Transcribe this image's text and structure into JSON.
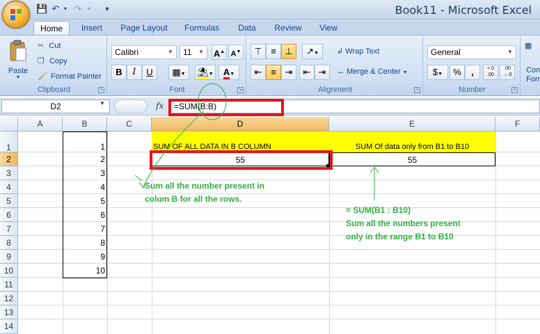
{
  "window": {
    "title": "Book11 - Microsoft Excel"
  },
  "tabs": [
    "Home",
    "Insert",
    "Page Layout",
    "Formulas",
    "Data",
    "Review",
    "View"
  ],
  "ribbon": {
    "clipboard": {
      "label": "Clipboard",
      "paste": "Paste",
      "cut": "Cut",
      "copy": "Copy",
      "format_painter": "Format Painter"
    },
    "font": {
      "label": "Font",
      "name": "Calibri",
      "size": "11",
      "bold": "B",
      "italic": "I",
      "underline": "U",
      "grow": "A",
      "shrink": "A",
      "font_color": "A"
    },
    "alignment": {
      "label": "Alignment",
      "wrap_text": "Wrap Text",
      "merge_center": "Merge & Center"
    },
    "number": {
      "label": "Number",
      "format": "General",
      "currency": "$",
      "percent": "%",
      "comma": ",",
      "inc_decimal": "+.0 .00",
      "dec_decimal": ".00 →.0"
    },
    "styles": {
      "cond_format": "Con",
      "cond_format_2": "Form"
    }
  },
  "formula_bar": {
    "name_box": "D2",
    "fx": "fx",
    "formula": "=SUM(B:B)"
  },
  "columns": [
    "A",
    "B",
    "C",
    "D",
    "E",
    "F"
  ],
  "rows": [
    "1",
    "2",
    "3",
    "4",
    "5",
    "6",
    "7",
    "8",
    "9",
    "10",
    "11",
    "12",
    "13",
    "14"
  ],
  "cells": {
    "B": [
      "1",
      "2",
      "3",
      "4",
      "5",
      "6",
      "7",
      "8",
      "9",
      "10"
    ],
    "D1": "SUM OF ALL DATA IN B COLUMN",
    "E1": "SUM Of data only  from B1 to B10",
    "D2": "55",
    "E2": "55"
  },
  "annotations": {
    "note_left_1": "Sum all the number present in",
    "note_left_2": "colum B for all the rows.",
    "note_right_1": "= SUM(B1 : B10)",
    "note_right_2": "Sum all the numbers present",
    "note_right_3": "only in the range B1 to B10"
  },
  "colors": {
    "highlight_red": "#e3151a",
    "note_green": "#2fae3f",
    "header_yellow": "#ffff00"
  }
}
